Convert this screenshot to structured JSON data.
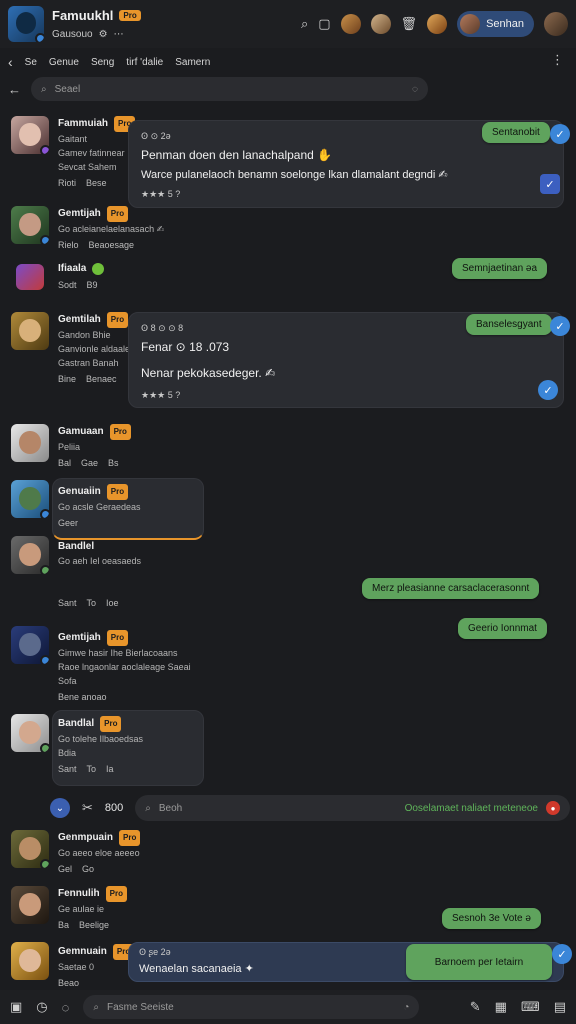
{
  "header": {
    "title": "Famuukhl",
    "badge": "Pro",
    "subtitle": "Gausouo",
    "sub_extra": "⚙",
    "user_chip": "Senhan"
  },
  "breadcrumb": {
    "items": [
      "Se",
      "Genue",
      "Seng",
      "tirf 'dalie",
      "Samern"
    ]
  },
  "search": {
    "placeholder": "Seael"
  },
  "posts": [
    {
      "name": "Fammuiah",
      "badge": "Pro",
      "line1": "Gaitant",
      "line2": "Gamev fatinnear",
      "line3": "Sevcat Sahem",
      "stats": [
        "Rioti",
        "Bese"
      ],
      "bubble_header": "Ꙩ ⊙ 2ǝ",
      "bubble_line1": "Penman doen den lanachalpand ✋",
      "bubble_line2": "Warce pulanelaoch benamn soelonge lkan dlamalant degndi ✍",
      "bubble_footer": "★★★ 5 ?",
      "green": "Sentanobit"
    },
    {
      "name": "Gemtijah",
      "badge": "Pro",
      "line1": "Go acleianelaelanasach ✍",
      "line2": "",
      "line3": "",
      "stats": [
        "Rielo",
        "Beaoesage"
      ]
    },
    {
      "name": "Ifiaala",
      "badge": "",
      "line1": "",
      "line2": "",
      "line3": "",
      "stats": [
        "Sodt",
        "B9"
      ],
      "green": "Semnjaetinan ǝa"
    },
    {
      "name": "Gemtilah",
      "badge": "Pro",
      "line1": "Gandon Bhie",
      "line2": "Ganvionle aldaalee",
      "line3": "Gastran Banah",
      "stats": [
        "Bine",
        "Benaec"
      ],
      "bubble_header": "Ꙩ 8 ⊙ ⊙ 8",
      "bubble_line1": "Fenar ⊙ 18 .073",
      "bubble_line2": "Nenar pekokasedeger. ✍",
      "bubble_footer": "★★★ 5 ?",
      "green": "Banselesgyant"
    },
    {
      "name": "Gamuaan",
      "badge": "Pro",
      "line1": "Peliia",
      "line2": "",
      "line3": "",
      "stats": [
        "Bal",
        "Gae",
        "Bs"
      ]
    },
    {
      "name": "Genuaiin",
      "badge": "Pro",
      "line1": "Go acsle Geraedeas",
      "line2": "",
      "line3": "",
      "stats": [
        "Geer"
      ]
    },
    {
      "name": "Bandlel",
      "badge": "",
      "line1": "Go aeh Iel oeasaeds",
      "line2": "",
      "line3": "",
      "stats": [
        "Sant",
        "To",
        "Ioe"
      ],
      "green": "Merz pleasianne carsaclacerasonnt",
      "green2": "Geerio Ionnmat"
    },
    {
      "name": "Gemtijah",
      "badge": "Pro",
      "line1": "Gimwe hasir Ihe Bierlacoaans",
      "line2": "Raoe lngaonlar aoclaleage Saeai",
      "line3": "Sofa",
      "stats": [
        "Bene anoao"
      ]
    },
    {
      "name": "Bandlal",
      "badge": "Pro",
      "line1": "Go tolehe Ilbaoedsas",
      "line2": "Bdia",
      "line3": "",
      "stats": [
        "Sant",
        "To",
        "Ia"
      ]
    },
    {
      "name": "Genmpuain",
      "badge": "Pro",
      "line1": "Go aeeo eloe aeeeo",
      "line2": "",
      "line3": "",
      "stats": [
        "Gel",
        "Go"
      ]
    },
    {
      "name": "Fennulih",
      "badge": "Pro",
      "line1": "Ge aulae ie",
      "line2": "",
      "line3": "",
      "stats": [
        "Ba",
        "Beelige"
      ],
      "green": "Sesnoh 3e Vote ǝ"
    },
    {
      "name": "Gemnuain",
      "badge": "Pro",
      "line1": "Saetae 0",
      "line2": "",
      "line3": "",
      "stats": [
        "Beao"
      ],
      "bubble_header": "Ꙩ ʂe 2ǝ",
      "bubble_line1": "Wenaelan sacanaeia ✦",
      "green": "Barnoem per Ietairn"
    }
  ],
  "mid_search": {
    "placeholder": "Beoh",
    "tag": "Ooselamaet naliaet meteneoe",
    "count": "800"
  },
  "bottom": {
    "placeholder": "Fasme Seeiste"
  },
  "colors": {
    "accent": "#3b86d8",
    "green": "#5fa35d",
    "badge": "#e8952b",
    "bg": "#1b1c1f"
  }
}
